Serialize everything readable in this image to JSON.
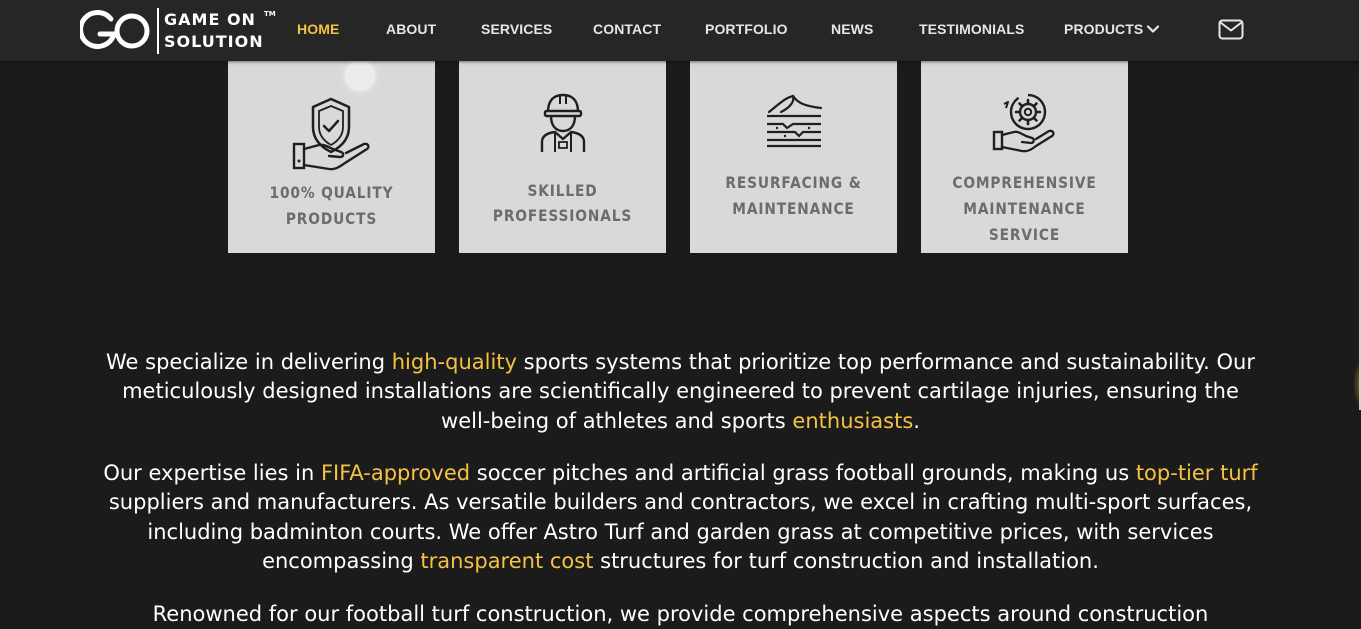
{
  "brand": {
    "name_line1": "GAME ON",
    "name_line2": "SOLUTION",
    "tm": "TM"
  },
  "nav": {
    "items": [
      "HOME",
      "ABOUT",
      "SERVICES",
      "CONTACT",
      "PORTFOLIO",
      "NEWS",
      "TESTIMONIALS",
      "PRODUCTS"
    ],
    "active": "HOME",
    "mail_icon": "envelope-icon",
    "dropdown_icon": "chevron-down-icon"
  },
  "colors": {
    "accent": "#f5c242",
    "background": "#1b1b1b",
    "navbar": "#262626",
    "card": "#d9d9d9",
    "card_text": "#6c6c6c"
  },
  "features": [
    {
      "icon": "quality-shield-hand-icon",
      "title_line1": "100% QUALITY",
      "title_line2": "PRODUCTS"
    },
    {
      "icon": "worker-helmet-icon",
      "title_line1": "SKILLED",
      "title_line2": "PROFESSIONALS"
    },
    {
      "icon": "resurfacing-layers-icon",
      "title_line1": "RESURFACING &",
      "title_line2": "MAINTENANCE"
    },
    {
      "icon": "gear-hand-icon",
      "title_line1": "COMPREHENSIVE",
      "title_line2": "MAINTENANCE SERVICE"
    }
  ],
  "paragraphs": {
    "p1": {
      "t1": "We specialize in delivering ",
      "h1": "high-quality",
      "t2": " sports systems that prioritize top performance and sustainability. Our meticulously designed installations are scientifically engineered to prevent cartilage injuries, ensuring the well-being of athletes and sports ",
      "h2": "enthusiasts",
      "t3": "."
    },
    "p2": {
      "t1": "Our expertise lies in ",
      "h1": "FIFA-approved",
      "t2": " soccer pitches and artificial grass football grounds, making us ",
      "h2": "top-tier turf",
      "t3": " suppliers and manufacturers. As versatile builders and contractors, we excel in crafting multi-sport surfaces, including badminton courts. We offer Astro Turf and garden grass at competitive prices, with services encompassing ",
      "h3": "transparent cost",
      "t4": " structures for turf construction and installation."
    },
    "p3": {
      "t1": "Renowned for our football turf construction, we provide comprehensive aspects around construction"
    }
  }
}
